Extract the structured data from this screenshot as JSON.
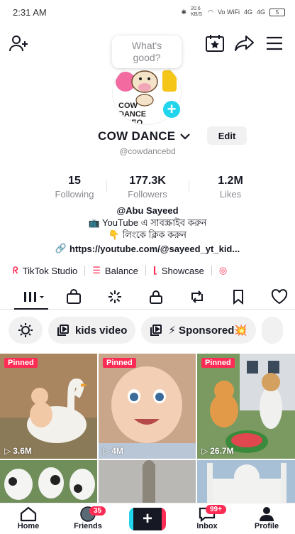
{
  "status_bar": {
    "time": "2:31 AM",
    "network_speed": "20.6 KB/S",
    "signal_labels": [
      "Vo WiFi",
      "4G",
      "4G"
    ],
    "battery": "5"
  },
  "header": {
    "add_friend_icon": "person-plus-icon",
    "calendar_icon": "calendar-star-icon",
    "share_icon": "share-icon",
    "menu_icon": "hamburger-menu-icon"
  },
  "bubble": {
    "text": "What's good?"
  },
  "profile": {
    "display_name": "COW DANCE",
    "username": "@cowdancebd",
    "edit_label": "Edit",
    "avatar_text": "COW DANCE VIDEO"
  },
  "stats": [
    {
      "value": "15",
      "label": "Following"
    },
    {
      "value": "177.3K",
      "label": "Followers"
    },
    {
      "value": "1.2M",
      "label": "Likes"
    }
  ],
  "bio": {
    "line1": "@Abu Sayeed",
    "line2": "📺 YouTube এ সাবস্ক্রাইব করুন",
    "line3": "👇 লিংকে ক্লিক করুন",
    "link": "https://youtube.com/@sayeed_yt_kid..."
  },
  "quick_links": [
    {
      "label": "TikTok Studio",
      "icon": "studio-icon"
    },
    {
      "label": "Balance",
      "icon": "balance-icon"
    },
    {
      "label": "Showcase",
      "icon": "showcase-icon"
    }
  ],
  "tabs": [
    "grid-icon",
    "shop-icon",
    "spark-icon",
    "lock-icon",
    "repost-icon",
    "bookmark-icon",
    "heart-icon"
  ],
  "chips": [
    {
      "label": "",
      "icon": "settings-circle-icon"
    },
    {
      "label": "kids video",
      "icon": "playlist-icon"
    },
    {
      "label": "⚡ Sponsored💥",
      "icon": "playlist-icon"
    }
  ],
  "videos": [
    {
      "pinned": "Pinned",
      "views": "3.6M",
      "bg": "#b89a78"
    },
    {
      "pinned": "Pinned",
      "views": "4M",
      "bg": "#d7b89a"
    },
    {
      "pinned": "Pinned",
      "views": "26.7M",
      "bg": "#7d8f5c"
    },
    {
      "pinned": "",
      "views": "",
      "bg": "#8e8a7e"
    },
    {
      "pinned": "",
      "views": "",
      "bg": "#a8a7a3"
    },
    {
      "pinned": "",
      "views": "",
      "bg": "#9bb3c7"
    }
  ],
  "bottom_nav": {
    "home": "Home",
    "friends": "Friends",
    "friends_badge": "35",
    "inbox": "Inbox",
    "inbox_badge": "99+",
    "profile": "Profile"
  },
  "colors": {
    "accent_red": "#fe2c55",
    "accent_cyan": "#20d5ec",
    "text": "#161823",
    "muted": "#8a8b91"
  }
}
